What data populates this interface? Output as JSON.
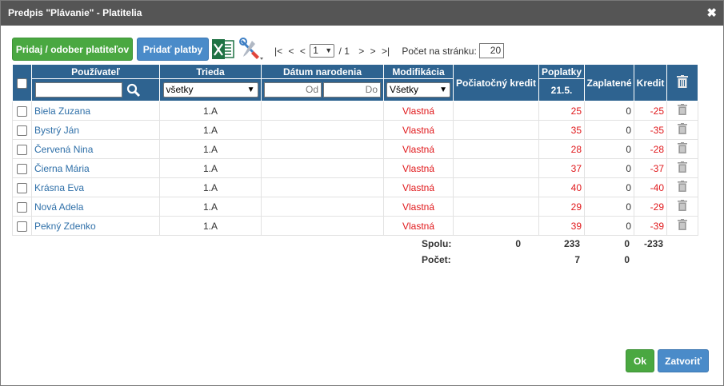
{
  "dialog": {
    "title": "Predpis \"Plávanie\" - Platitelia",
    "close_glyph": "✖"
  },
  "toolbar": {
    "add_remove_payers_label": "Pridaj / odober platiteľov",
    "add_payments_label": "Pridať platby",
    "excel_icon": "excel-icon",
    "tools_icon": "tools-icon"
  },
  "pager": {
    "first": "|<",
    "prev2": "<",
    "prev": "<",
    "page": "1",
    "of": "/ 1",
    "next": ">",
    "next2": ">",
    "last": ">|",
    "per_page_label": "Počet na stránku:",
    "per_page_value": "20"
  },
  "table": {
    "headers": {
      "user": "Používateľ",
      "class": "Trieda",
      "birth_date": "Dátum narodenia",
      "modification": "Modifikácia",
      "initial_credit": "Počiatočný kredit",
      "fees": "Poplatky",
      "fee_date": "21.5.",
      "paid": "Zaplatené",
      "credit": "Kredit"
    },
    "filters": {
      "class_value": "všetky",
      "date_from_placeholder": "Od",
      "date_to_placeholder": "Do",
      "modification_value": "Všetky"
    },
    "rows": [
      {
        "name": "Biela Zuzana",
        "class": "1.A",
        "birth": "",
        "modification": "Vlastná",
        "initial": "",
        "fee": "25",
        "paid": "0",
        "credit": "-25"
      },
      {
        "name": "Bystrý Ján",
        "class": "1.A",
        "birth": "",
        "modification": "Vlastná",
        "initial": "",
        "fee": "35",
        "paid": "0",
        "credit": "-35"
      },
      {
        "name": "Červená Nina",
        "class": "1.A",
        "birth": "",
        "modification": "Vlastná",
        "initial": "",
        "fee": "28",
        "paid": "0",
        "credit": "-28"
      },
      {
        "name": "Čierna Mária",
        "class": "1.A",
        "birth": "",
        "modification": "Vlastná",
        "initial": "",
        "fee": "37",
        "paid": "0",
        "credit": "-37"
      },
      {
        "name": "Krásna Eva",
        "class": "1.A",
        "birth": "",
        "modification": "Vlastná",
        "initial": "",
        "fee": "40",
        "paid": "0",
        "credit": "-40"
      },
      {
        "name": "Nová Adela",
        "class": "1.A",
        "birth": "",
        "modification": "Vlastná",
        "initial": "",
        "fee": "29",
        "paid": "0",
        "credit": "-29"
      },
      {
        "name": "Pekný Zdenko",
        "class": "1.A",
        "birth": "",
        "modification": "Vlastná",
        "initial": "",
        "fee": "39",
        "paid": "0",
        "credit": "-39"
      }
    ]
  },
  "totals": {
    "sum_label": "Spolu:",
    "sum_initial": "0",
    "sum_fees": "233",
    "sum_paid": "0",
    "sum_credit": "-233",
    "count_label": "Počet:",
    "count_fees": "7",
    "count_paid": "0"
  },
  "footer": {
    "ok_label": "Ok",
    "close_label": "Zatvoriť"
  },
  "colors": {
    "header_bg": "#2e6390",
    "green": "#4aa841",
    "blue": "#4a8bc9",
    "red": "#e0181b",
    "link": "#2e6fa8"
  }
}
